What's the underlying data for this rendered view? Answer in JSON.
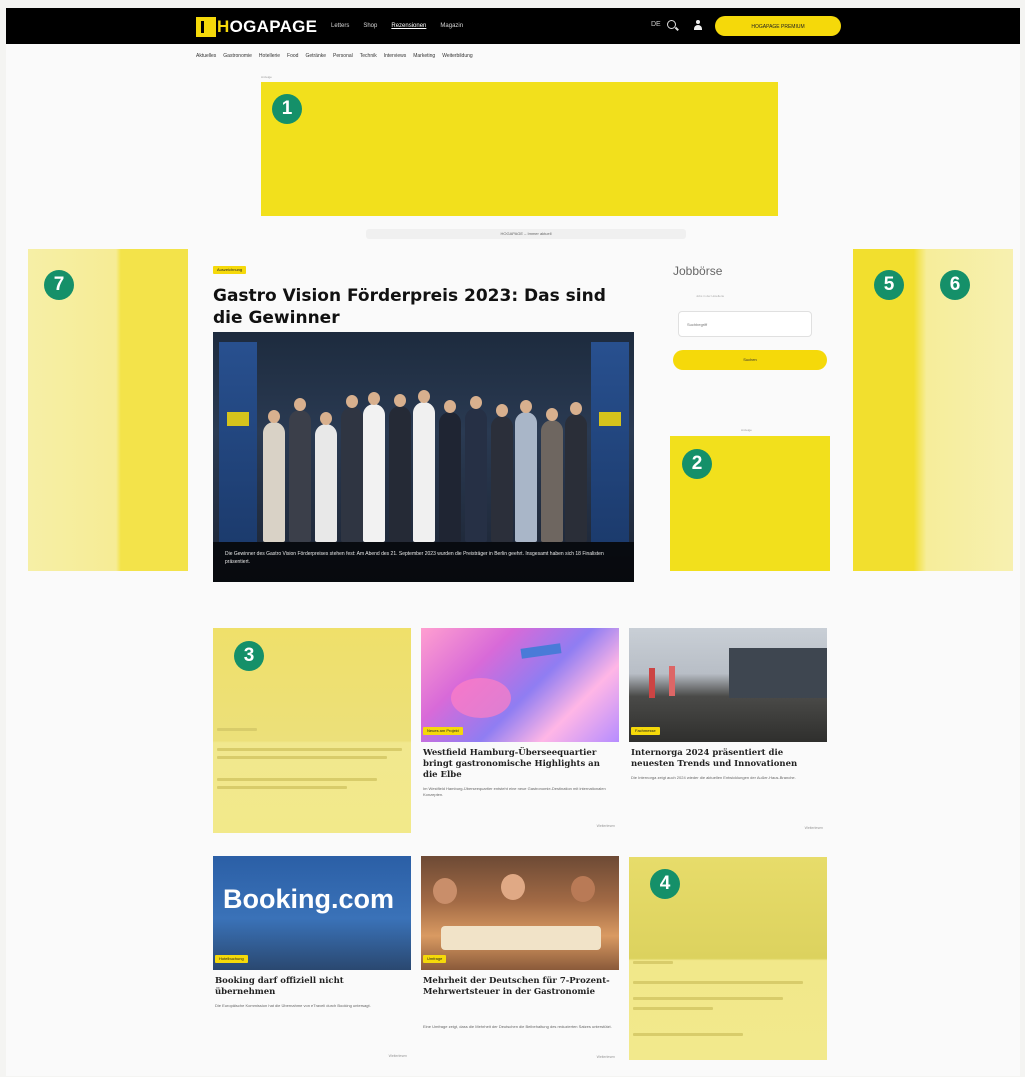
{
  "header": {
    "logo_prefix": "H",
    "logo_main": "OGAPAGE",
    "nav": [
      "Letters",
      "Shop",
      "Rezensionen",
      "Magazin"
    ],
    "language": "DE",
    "cta_label": "HOGAPAGE PREMIUM",
    "categories": [
      "Aktuelles",
      "Gastronomie",
      "Hotellerie",
      "Food",
      "Getränke",
      "Personal",
      "Technik",
      "Interviews",
      "Marketing",
      "Weiterbildung"
    ]
  },
  "ad_labels": {
    "top": "Anzeige",
    "sidebar": "Anzeige"
  },
  "teaser_strip": "HOGAPAGE – Immer aktuell",
  "markers": [
    "1",
    "2",
    "3",
    "4",
    "5",
    "6",
    "7"
  ],
  "lead": {
    "kicker": "Auszeichnung",
    "title": "Gastro Vision Förderpreis 2023: Das sind die Gewinner",
    "caption": "Die Gewinner des Gastro Vision Förderpreises stehen fest: Am Abend des 21. September 2023 wurden die Preisträger in Berlin geehrt. Insgesamt haben sich 18 Finalisten präsentiert."
  },
  "jobs": {
    "title": "Jobbörse",
    "subtitle": "Jobs in der Hotellerie",
    "input_placeholder": "Suchbegriff",
    "button_label": "Suchen"
  },
  "cards": [
    {
      "kicker": "Neues am Projekt",
      "title": "Westfield Hamburg-Überseequartier bringt gastronomische Highlights an die Elbe",
      "teaser": "Im Westfield Hamburg-Überseequartier entsteht eine neue Gastronomie-Destination mit internationalen Konzepten.",
      "more": "Weiterlesen"
    },
    {
      "kicker": "Fachmesse",
      "title": "Internorga 2024 präsentiert die neuesten Trends und Innovationen",
      "teaser": "Die Internorga zeigt auch 2024 wieder die aktuellen Entwicklungen der Außer-Haus-Branche.",
      "more": "Weiterlesen"
    },
    {
      "kicker": "Hotelbuchung",
      "title": "Booking darf offiziell nicht übernehmen",
      "teaser": "Die Europäische Kommission hat die Übernahme von eTraveli durch Booking untersagt.",
      "more": "Weiterlesen",
      "logo": "Booking.com"
    },
    {
      "kicker": "Umfrage",
      "title": "Mehrheit der Deutschen für 7-Prozent-Mehrwertsteuer in der Gastronomie",
      "teaser": "Eine Umfrage zeigt, dass die Mehrheit der Deutschen die Beibehaltung des reduzierten Satzes unterstützt.",
      "more": "Weiterlesen"
    }
  ]
}
